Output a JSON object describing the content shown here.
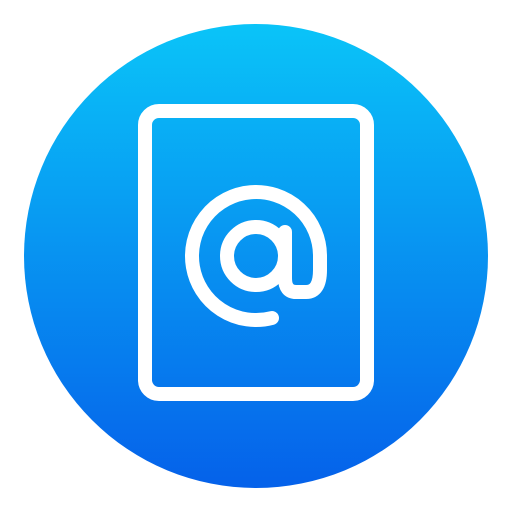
{
  "icon": {
    "name": "email-document-icon",
    "glyph": "at-sign-icon",
    "colors": {
      "gradient_top": "#0ac4f8",
      "gradient_bottom": "#0561ea",
      "stroke": "#ffffff",
      "background": "#ffffff"
    }
  }
}
